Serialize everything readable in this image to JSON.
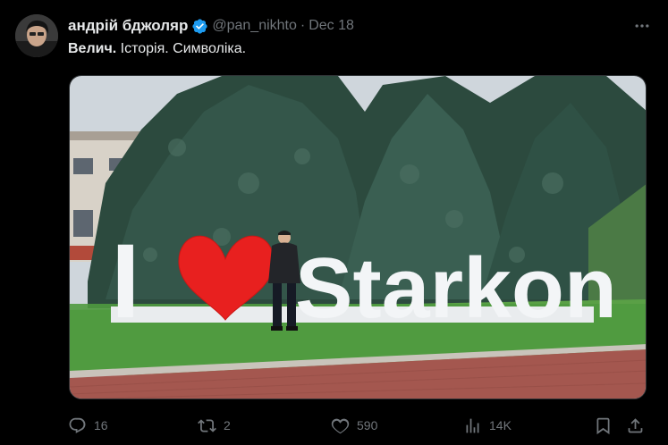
{
  "tweet": {
    "author_name": "андрій бджоляр",
    "handle": "@pan_nikhto",
    "separator": "·",
    "date": "Dec 18",
    "text_bold": "Велич.",
    "text_rest": " Історія. Символіка."
  },
  "media": {
    "sign_text_left": "I",
    "sign_text_right": "Starkon"
  },
  "actions": {
    "replies": "16",
    "reposts": "2",
    "likes": "590",
    "views": "14K"
  },
  "colors": {
    "background": "#000000",
    "text": "#e7e9ea",
    "muted": "#71767b",
    "verified": "#1d9bf0",
    "heart": "#e8201f"
  },
  "icons": [
    "more-icon",
    "verified-badge-icon",
    "reply-icon",
    "repost-icon",
    "like-icon",
    "views-icon",
    "bookmark-icon",
    "share-icon"
  ]
}
